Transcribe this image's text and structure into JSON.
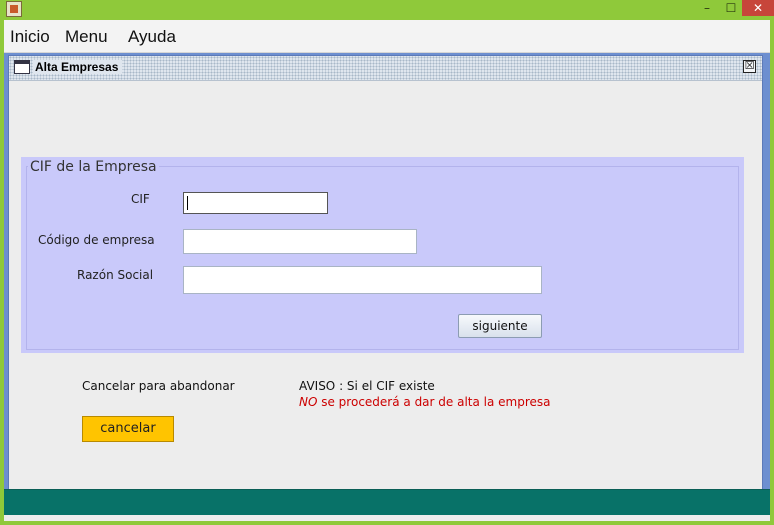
{
  "window": {
    "controls": {
      "minimize": "–",
      "maximize": "☐",
      "close": "✕"
    },
    "icon": "java-app-icon"
  },
  "menubar": {
    "items": [
      "Inicio",
      "Menu",
      "Ayuda"
    ]
  },
  "internal_frame": {
    "title": "Alta Empresas",
    "close_symbol": "☒",
    "icon": "window-frame-icon"
  },
  "panel": {
    "legend": "CIF de la Empresa",
    "fields": [
      {
        "label": "CIF",
        "value": "",
        "focused": true
      },
      {
        "label": "Código de empresa",
        "value": ""
      },
      {
        "label": "Razón Social",
        "value": ""
      }
    ],
    "next_button": "siguiente"
  },
  "footer": {
    "cancel_hint": "Cancelar para abandonar",
    "warning_line1": "AVISO : Si el CIF existe",
    "warning_line2_emph": "NO",
    "warning_line2_rest": " se procederá a dar de alta la empresa",
    "cancel_button": "cancelar"
  },
  "colors": {
    "os_titlebar": "#8fc93a",
    "desktop": "#6d8fd0",
    "panel": "#c9c9fa",
    "warning_text": "#cc0000",
    "cancel_button": "#ffc400",
    "statusbar": "#087268"
  }
}
